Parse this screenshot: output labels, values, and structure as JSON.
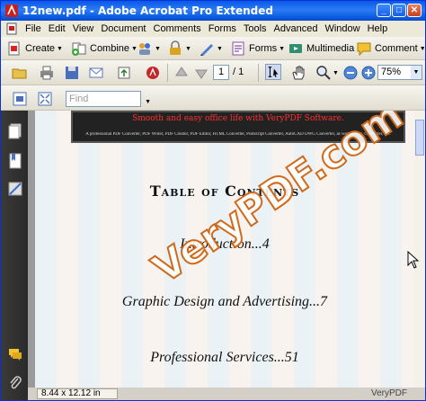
{
  "window": {
    "title": "12new.pdf - Adobe Acrobat Pro Extended",
    "controls": {
      "minimize": "_",
      "maximize": "□",
      "close": "✕"
    }
  },
  "menu": [
    "File",
    "Edit",
    "View",
    "Document",
    "Comments",
    "Forms",
    "Tools",
    "Advanced",
    "Window",
    "Help"
  ],
  "toolbar1": {
    "create": "Create",
    "combine": "Combine",
    "forms": "Forms",
    "multimedia": "Multimedia",
    "comment": "Comment"
  },
  "toolbar2": {
    "page_current": "1",
    "page_total": "/ 1",
    "zoom": "75%"
  },
  "toolbar3": {
    "find_placeholder": "Find"
  },
  "document": {
    "banner_red": "Smooth and easy office life with VeryPDF Software.",
    "banner_small": "A professional PDF Converter, PDF Writer, PDF Creator, PDF Editor, HTML Converter, Postscript Converter, AutoCAD DWG Converter, as well as PCL Converter, etc.",
    "toc_title": "Table of Contents",
    "toc_items": [
      "Introduction...4",
      "Graphic Design and Advertising...7",
      "Professional Services...51"
    ],
    "watermark": "VeryPDF.com"
  },
  "status": {
    "page_size": "8.44 x 12.12 in"
  },
  "brand": "VeryPDF",
  "colors": {
    "titlebar": "#0a58e8",
    "navpane": "#2a2a2a",
    "banner_text": "#ff3030",
    "watermark_stroke": "#d06a1a"
  }
}
